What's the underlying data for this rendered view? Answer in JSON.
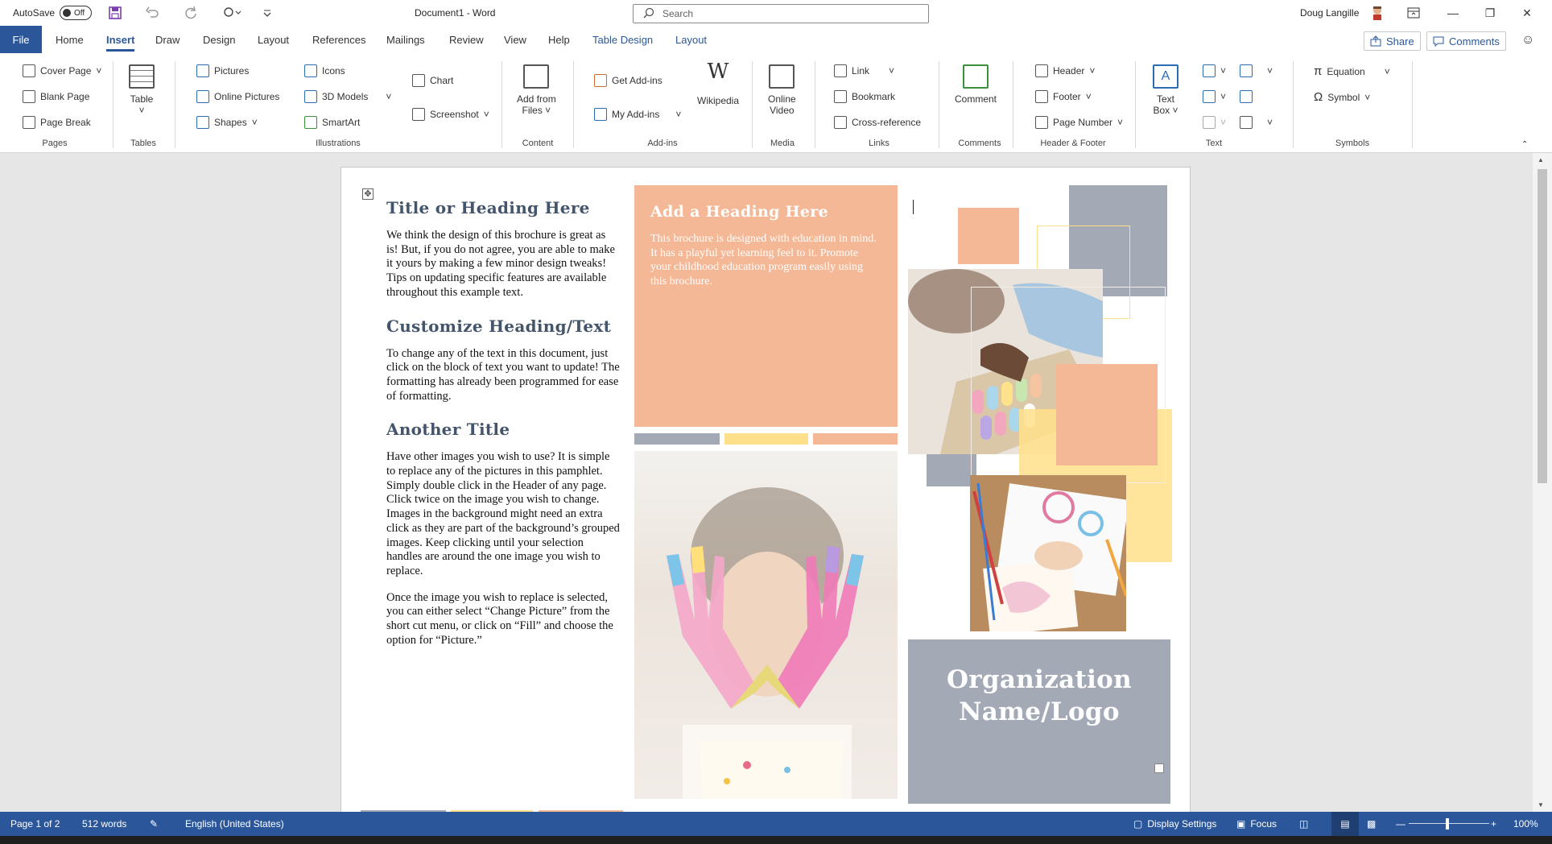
{
  "titlebar": {
    "autosave_label": "AutoSave",
    "autosave_state": "Off",
    "document_title": "Document1 - Word",
    "search_placeholder": "Search",
    "user_name": "Doug Langille"
  },
  "menu": {
    "tabs": [
      "File",
      "Home",
      "Insert",
      "Draw",
      "Design",
      "Layout",
      "References",
      "Mailings",
      "Review",
      "View",
      "Help",
      "Table Design",
      "Layout"
    ],
    "active_tab": "Insert",
    "share_label": "Share",
    "comments_label": "Comments"
  },
  "ribbon": {
    "pages": {
      "cover_page": "Cover Page",
      "blank_page": "Blank Page",
      "page_break": "Page Break",
      "label": "Pages"
    },
    "tables": {
      "table": "Table",
      "label": "Tables"
    },
    "illustrations": {
      "pictures": "Pictures",
      "online_pictures": "Online Pictures",
      "shapes": "Shapes",
      "icons": "Icons",
      "models_3d": "3D Models",
      "smartart": "SmartArt",
      "chart": "Chart",
      "screenshot": "Screenshot",
      "label": "Illustrations"
    },
    "content": {
      "add_from_files_1": "Add from",
      "add_from_files_2": "Files",
      "label": "Content"
    },
    "addins": {
      "get_addins": "Get Add-ins",
      "my_addins": "My Add-ins",
      "wikipedia": "Wikipedia",
      "label": "Add-ins"
    },
    "media": {
      "online_video_1": "Online",
      "online_video_2": "Video",
      "label": "Media"
    },
    "links": {
      "link": "Link",
      "bookmark": "Bookmark",
      "cross_reference": "Cross-reference",
      "label": "Links"
    },
    "comments": {
      "comment": "Comment",
      "label": "Comments"
    },
    "header_footer": {
      "header": "Header",
      "footer": "Footer",
      "page_number": "Page Number",
      "label": "Header & Footer"
    },
    "text": {
      "text_box_1": "Text",
      "text_box_2": "Box",
      "label": "Text"
    },
    "symbols": {
      "equation": "Equation",
      "symbol": "Symbol",
      "label": "Symbols"
    }
  },
  "document": {
    "heading1": "Title or Heading Here",
    "para1": "We think the design of this brochure is great as is!  But, if you do not agree, you are able to make it yours by making a few minor design tweaks!  Tips on updating specific features are available throughout this example text.",
    "heading2": "Customize Heading/Text",
    "para2": "To change any of the text in this document, just click on the block of text you want to update!  The formatting has already been programmed for ease of formatting.",
    "heading3": "Another Title",
    "para3": "Have other images you wish to use?  It is simple to replace any of the pictures in this pamphlet.  Simply double click in the Header of any page.  Click twice on the image you wish to change.  Images in the background might need an extra click as they are part of the background’s grouped images.  Keep clicking until your selection handles are around the one image you wish to replace.",
    "para4": "Once the image you wish to replace is selected, you can either select “Change Picture” from the short cut menu, or click on “Fill” and choose the option for “Picture.”",
    "panel_heading": "Add a Heading Here",
    "panel_text": "This brochure is designed with education in mind.  It has a playful yet learning feel to it.  Promote your childhood education program easily using this brochure.",
    "org_line1": "Organization",
    "org_line2": "Name/Logo"
  },
  "statusbar": {
    "page": "Page 1 of 2",
    "words": "512 words",
    "language": "English (United States)",
    "display_settings": "Display Settings",
    "focus": "Focus",
    "zoom": "100%"
  },
  "colors": {
    "word_blue": "#2b579a",
    "peach": "#f4b896",
    "gray": "#a3a9b5",
    "yellow": "#ffe08a",
    "heading": "#44546a"
  }
}
